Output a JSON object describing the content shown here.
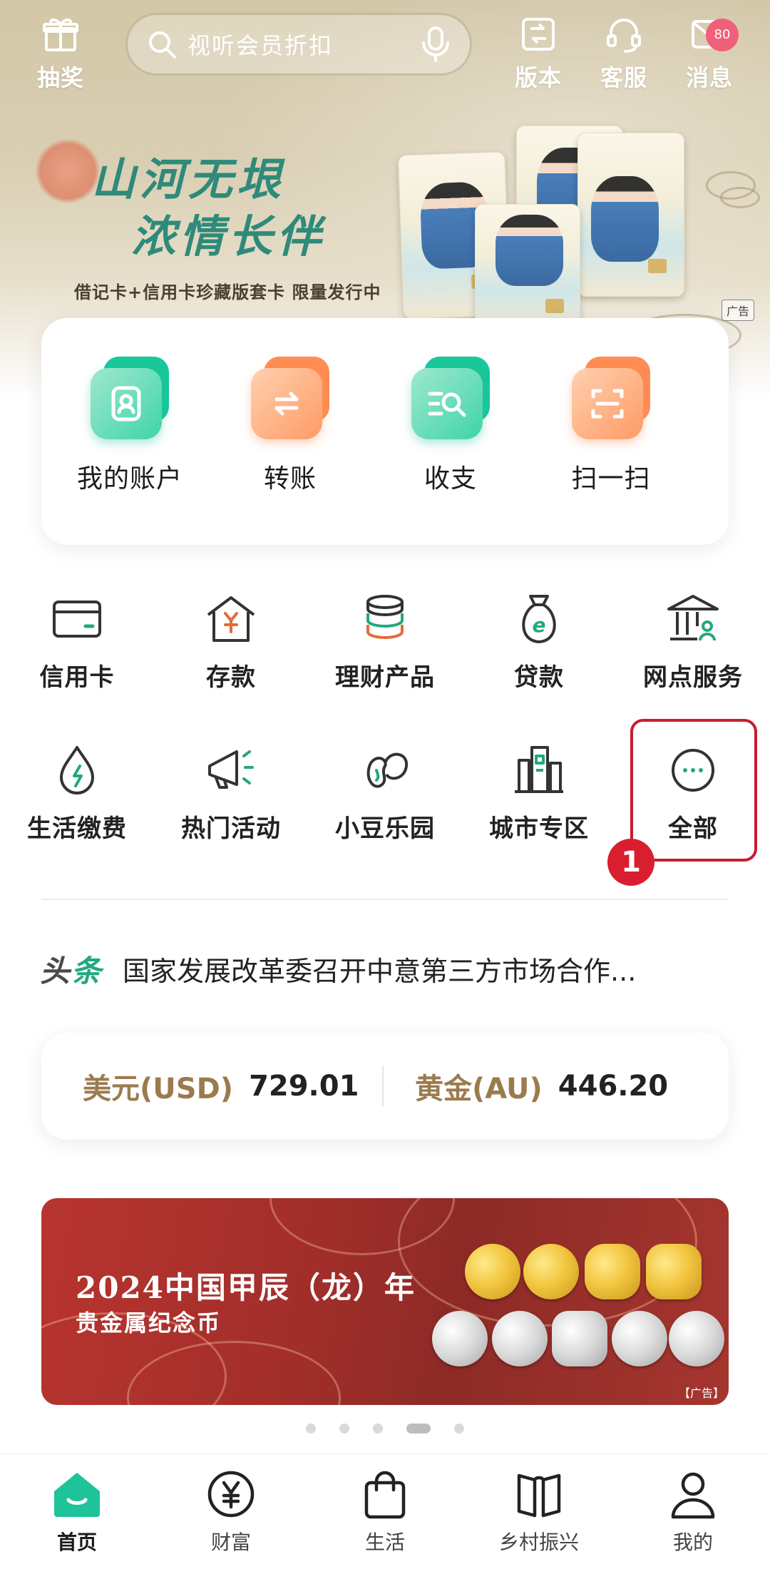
{
  "top_bar": {
    "lottery_label": "抽奖",
    "search_placeholder": "视听会员折扣",
    "version_label": "版本",
    "service_label": "客服",
    "message_label": "消息",
    "message_badge": "80"
  },
  "hero": {
    "title_line1": "山河无垠",
    "title_line2": "浓情长伴",
    "subtitle": "借记卡+信用卡珍藏版套卡 限量发行中",
    "ad_tag": "广告"
  },
  "quick_actions": [
    {
      "label": "我的账户",
      "icon": "account-icon",
      "color": "green"
    },
    {
      "label": "转账",
      "icon": "transfer-icon",
      "color": "orange"
    },
    {
      "label": "收支",
      "icon": "income-expense-icon",
      "color": "green"
    },
    {
      "label": "扫一扫",
      "icon": "scan-icon",
      "color": "orange"
    }
  ],
  "services_row1": [
    {
      "label": "信用卡",
      "icon": "credit-card-icon"
    },
    {
      "label": "存款",
      "icon": "deposit-icon"
    },
    {
      "label": "理财产品",
      "icon": "wealth-product-icon"
    },
    {
      "label": "贷款",
      "icon": "loan-icon"
    },
    {
      "label": "网点服务",
      "icon": "branch-service-icon"
    }
  ],
  "services_row2": [
    {
      "label": "生活缴费",
      "icon": "utility-payment-icon"
    },
    {
      "label": "热门活动",
      "icon": "megaphone-icon"
    },
    {
      "label": "小豆乐园",
      "icon": "bean-icon"
    },
    {
      "label": "城市专区",
      "icon": "city-icon"
    },
    {
      "label": "全部",
      "icon": "more-icon"
    }
  ],
  "annotation": {
    "step_number": "1",
    "highlight_color": "#c81d2e"
  },
  "headline": {
    "tag_part1": "头",
    "tag_part2": "条",
    "text": "国家发展改革委召开中意第三方市场合作..."
  },
  "rates": [
    {
      "name": "美元(USD)",
      "value": "729.01"
    },
    {
      "name": "黄金(AU)",
      "value": "446.20"
    }
  ],
  "promo": {
    "title": "2024中国甲辰（龙）年",
    "subtitle": "贵金属纪念币",
    "ad_tag": "【广告】"
  },
  "carousel": {
    "count": 5,
    "active": 3
  },
  "bottom_nav": [
    {
      "label": "首页",
      "icon": "home-icon",
      "active": true
    },
    {
      "label": "财富",
      "icon": "yuan-icon",
      "active": false
    },
    {
      "label": "生活",
      "icon": "shopping-bag-icon",
      "active": false
    },
    {
      "label": "乡村振兴",
      "icon": "book-icon",
      "active": false
    },
    {
      "label": "我的",
      "icon": "user-icon",
      "active": false
    }
  ],
  "colors": {
    "brand_green": "#23a87e",
    "accent_orange": "#ff9a66",
    "rate_gold": "#9b7b4e",
    "badge_pink": "#f0607a"
  }
}
